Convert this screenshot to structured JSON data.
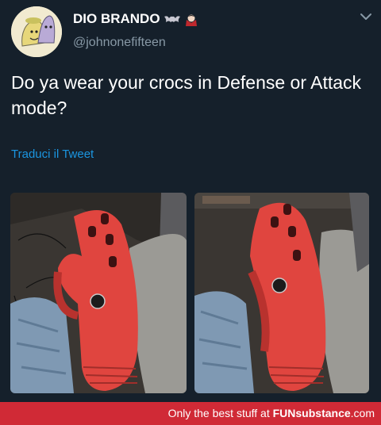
{
  "tweet": {
    "display_name": "DIO BRANDO",
    "name_emojis": [
      "bat-emoji",
      "vampire-emoji"
    ],
    "handle": "@johnonefifteen",
    "text": "Do ya wear your crocs in Defense or Attack mode?",
    "translate_link": "Traduci il Tweet",
    "photos": [
      "photo-crocs-defense-mode",
      "photo-crocs-attack-mode"
    ]
  },
  "footer": {
    "tagline": "Only the best stuff at",
    "brand_bold": "FUNsubstance",
    "brand_suffix": ".com"
  },
  "colors": {
    "background": "#15202b",
    "handle": "#8899a6",
    "link": "#1b95e0",
    "footer": "#d02a36",
    "croc": "#e0453f"
  }
}
